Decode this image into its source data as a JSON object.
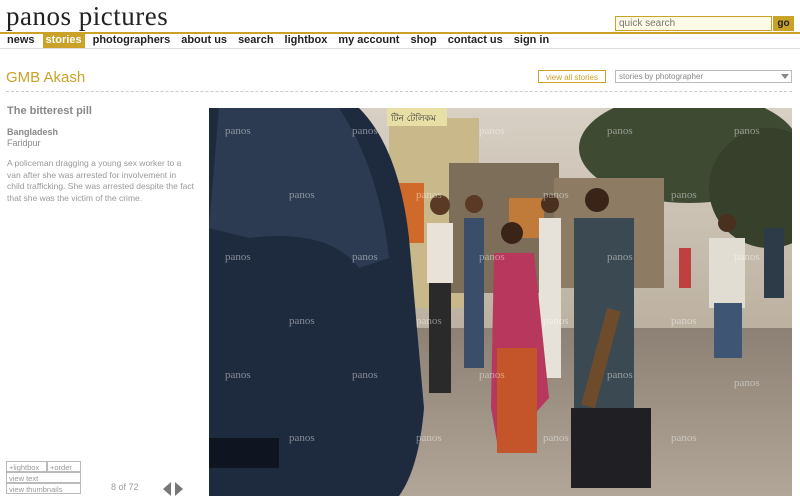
{
  "header": {
    "site_title": "panos pictures",
    "search_placeholder": "quick search",
    "search_go": "go"
  },
  "nav": [
    {
      "label": "news",
      "active": false
    },
    {
      "label": "stories",
      "active": true
    },
    {
      "label": "photographers",
      "active": false
    },
    {
      "label": "about us",
      "active": false
    },
    {
      "label": "search",
      "active": false
    },
    {
      "label": "lightbox",
      "active": false
    },
    {
      "label": "my account",
      "active": false
    },
    {
      "label": "shop",
      "active": false
    },
    {
      "label": "contact us",
      "active": false
    },
    {
      "label": "sign in",
      "active": false
    }
  ],
  "photographer": {
    "name": "GMB Akash",
    "view_all_label": "view all stories",
    "select_value": "stories by photographer"
  },
  "story": {
    "title": "The bitterest pill",
    "country": "Bangladesh",
    "city": "Faridpur",
    "caption": "A policeman dragging a young sex worker to a van after she was arrested for involvement in child trafficking. She was arrested despite the fact that she was the victim of the crime."
  },
  "photo": {
    "watermark": "panos",
    "sign_text": "টিন টেলিকম"
  },
  "actions": {
    "add_lightbox": "+lightbox",
    "add_order": "+order",
    "view_text": "view text",
    "view_thumbnails": "view thumbnails"
  },
  "pager": {
    "counter": "8 of 72"
  },
  "colors": {
    "accent": "#c9a227",
    "text": "#333333",
    "muted": "#999999"
  }
}
